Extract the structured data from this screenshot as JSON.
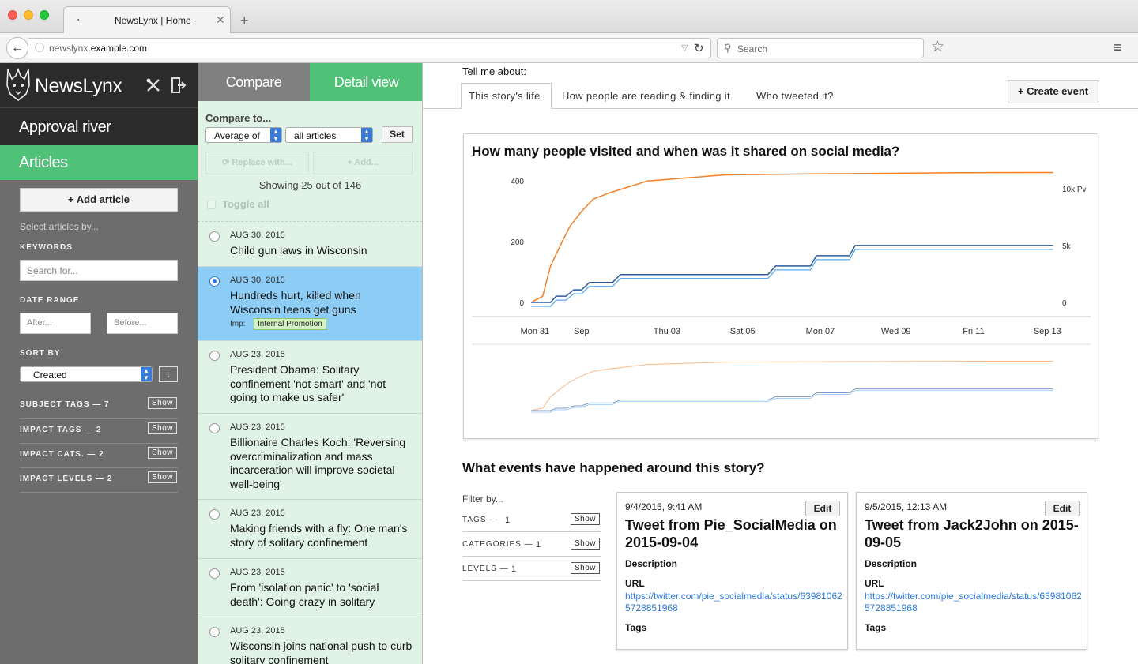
{
  "browser": {
    "tab_title": "NewsLynx | Home",
    "tab_close": "✕",
    "new_tab": "+",
    "url_prefix": "newslynx.",
    "url_domain": "example.com",
    "search_placeholder": "Search"
  },
  "sidebar": {
    "brand": "NewsLynx",
    "nav_approval": "Approval river",
    "nav_articles": "Articles",
    "add_article": "+ Add article",
    "select_by": "Select articles by...",
    "keywords_label": "KEYWORDS",
    "keywords_placeholder": "Search for...",
    "date_range_label": "DATE RANGE",
    "after_placeholder": "After...",
    "before_placeholder": "Before...",
    "sort_by_label": "SORT BY",
    "sort_value": "Created",
    "sort_dir": "↓",
    "filters": [
      {
        "label": "SUBJECT TAGS — 7",
        "button": "Show"
      },
      {
        "label": "IMPACT TAGS — 2",
        "button": "Show"
      },
      {
        "label": "IMPACT CATS. — 2",
        "button": "Show"
      },
      {
        "label": "IMPACT LEVELS — 2",
        "button": "Show"
      }
    ]
  },
  "articles_panel": {
    "tab_compare": "Compare",
    "tab_detail": "Detail view",
    "compare_to": "Compare to...",
    "compare_mode": "Average of",
    "compare_scope": "all articles",
    "set_button": "Set",
    "replace_button": "Replace with...",
    "add_button": "+ Add...",
    "showing": "Showing 25 out of 146",
    "toggle_all": "Toggle all",
    "items": [
      {
        "date": "AUG 30, 2015",
        "title": "Child gun laws in Wisconsin"
      },
      {
        "date": "AUG 30, 2015",
        "title": "Hundreds hurt, killed when Wisconsin teens get guns",
        "imp_label": "Imp:",
        "imp_tag": "Internal Promotion"
      },
      {
        "date": "AUG 23, 2015",
        "title": "President Obama: Solitary confinement 'not smart' and 'not going to make us safer'"
      },
      {
        "date": "AUG 23, 2015",
        "title": "Billionaire Charles Koch: 'Reversing overcriminalization and mass incarceration will improve societal well-being'"
      },
      {
        "date": "AUG 23, 2015",
        "title": "Making friends with a fly: One man's story of solitary confinement"
      },
      {
        "date": "AUG 23, 2015",
        "title": "From 'isolation panic' to 'social death': Going crazy in solitary"
      },
      {
        "date": "AUG 23, 2015",
        "title": "Wisconsin joins national push to curb solitary confinement"
      }
    ]
  },
  "main": {
    "tell_me": "Tell me about:",
    "tabs": [
      "This story's life",
      "How people are reading & finding it",
      "Who tweeted it?"
    ],
    "create_event": "+ Create event",
    "chart_title": "How many people visited and when was it shared on social media?",
    "events_title": "What events have happened around this story?",
    "filter_by": "Filter by...",
    "event_filters": [
      {
        "label": "TAGS —",
        "count": "1",
        "button": "Show"
      },
      {
        "label": "CATEGORIES —",
        "count": "1",
        "button": "Show"
      },
      {
        "label": "LEVELS —",
        "count": "1",
        "button": "Show"
      }
    ],
    "events": [
      {
        "timestamp": "9/4/2015, 9:41 AM",
        "edit": "Edit",
        "title": "Tweet from Pie_SocialMedia on 2015-09-04",
        "description_label": "Description",
        "url_label": "URL",
        "url": "https://twitter.com/pie_socialmedia/status/639810625728851968",
        "tags_label": "Tags"
      },
      {
        "timestamp": "9/5/2015, 12:13 AM",
        "edit": "Edit",
        "title": "Tweet from Jack2John on 2015-09-05",
        "description_label": "Description",
        "url_label": "URL",
        "url": "https://twitter.com/pie_socialmedia/status/639810625728851968",
        "tags_label": "Tags"
      }
    ]
  },
  "chart_data": {
    "type": "line",
    "title": "How many people visited and when was it shared on social media?",
    "x_ticks": [
      "Mon 31",
      "Sep",
      "Thu 03",
      "Sat 05",
      "Mon 07",
      "Wed 09",
      "Fri 11",
      "Sep 13"
    ],
    "y_left_ticks": [
      "0",
      "200",
      "400"
    ],
    "y_left_range": [
      0,
      450
    ],
    "y_right_ticks": [
      "0",
      "5k",
      "10k Pv"
    ],
    "y_right_range": [
      0,
      12000
    ],
    "series": [
      {
        "axis": "left",
        "color": "#f0812b",
        "x": [
          0,
          0.3,
          0.5,
          0.8,
          1.0,
          1.3,
          1.6,
          2.0,
          2.5,
          3.0,
          4.0,
          5.0,
          7.0,
          9.0,
          11.0,
          13.45
        ],
        "y": [
          0,
          20,
          120,
          200,
          250,
          300,
          340,
          360,
          380,
          400,
          410,
          420,
          423,
          425,
          427,
          428
        ]
      },
      {
        "axis": "right",
        "color": "#2d5a99",
        "x": [
          0,
          0.5,
          0.65,
          0.9,
          1.1,
          1.3,
          1.5,
          2.1,
          2.3,
          4.1,
          4.3,
          6.1,
          6.3,
          7.2,
          7.35,
          8.2,
          8.35,
          13.45
        ],
        "y": [
          0,
          0,
          550,
          550,
          1100,
          1100,
          1750,
          1750,
          2450,
          2450,
          2450,
          2450,
          3200,
          3200,
          4100,
          4100,
          5000,
          5000
        ]
      }
    ],
    "legend": []
  }
}
